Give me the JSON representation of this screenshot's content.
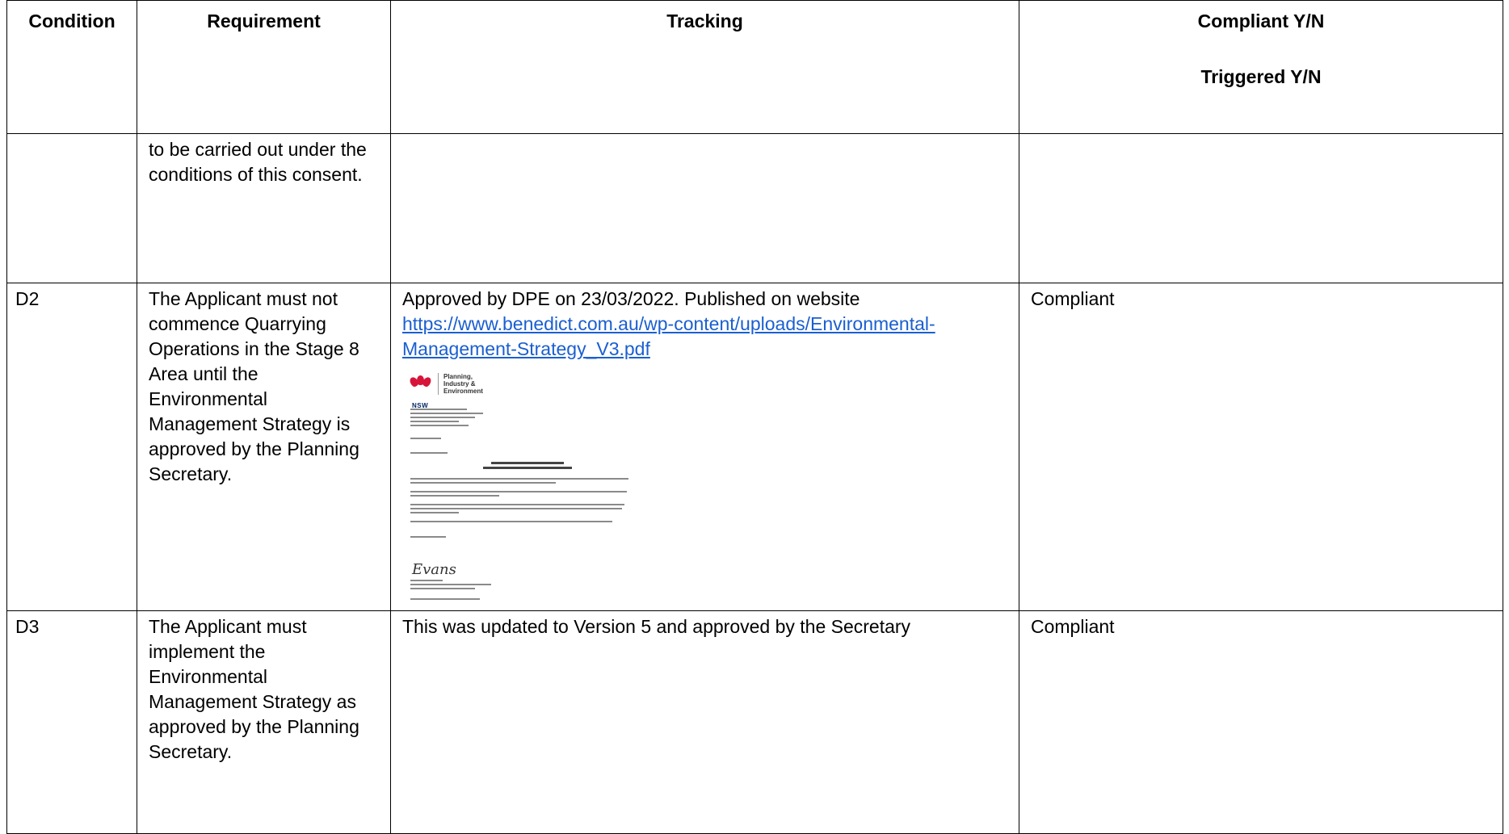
{
  "headers": {
    "condition": "Condition",
    "requirement": "Requirement",
    "tracking": "Tracking",
    "compliant": "Compliant Y/N",
    "triggered": "Triggered Y/N"
  },
  "rows": [
    {
      "condition": "",
      "requirement": "to be carried out under the conditions of this consent.",
      "tracking": "",
      "status": ""
    },
    {
      "condition": "D2",
      "requirement": "The Applicant must not commence Quarrying Operations in the Stage 8 Area until the Environmental Management Strategy is approved by the Planning Secretary.",
      "tracking_text": "Approved by DPE on 23/03/2022. Published on website",
      "tracking_link": "https://www.benedict.com.au/wp-content/uploads/Environmental-Management-Strategy_V3.pdf",
      "letter_logo": "Planning, Industry & Environment",
      "letter_nsw": "NSW",
      "status": "Compliant"
    },
    {
      "condition": "D3",
      "requirement": "The Applicant must implement the Environmental Management Strategy as approved by the Planning Secretary.",
      "tracking": "This was updated to Version 5 and approved by the Secretary",
      "status": "Compliant"
    }
  ],
  "colors": {
    "link": "#1a5fd0",
    "border": "#000000"
  },
  "icons": {
    "letter_logo": "nsw-waratah-icon"
  }
}
